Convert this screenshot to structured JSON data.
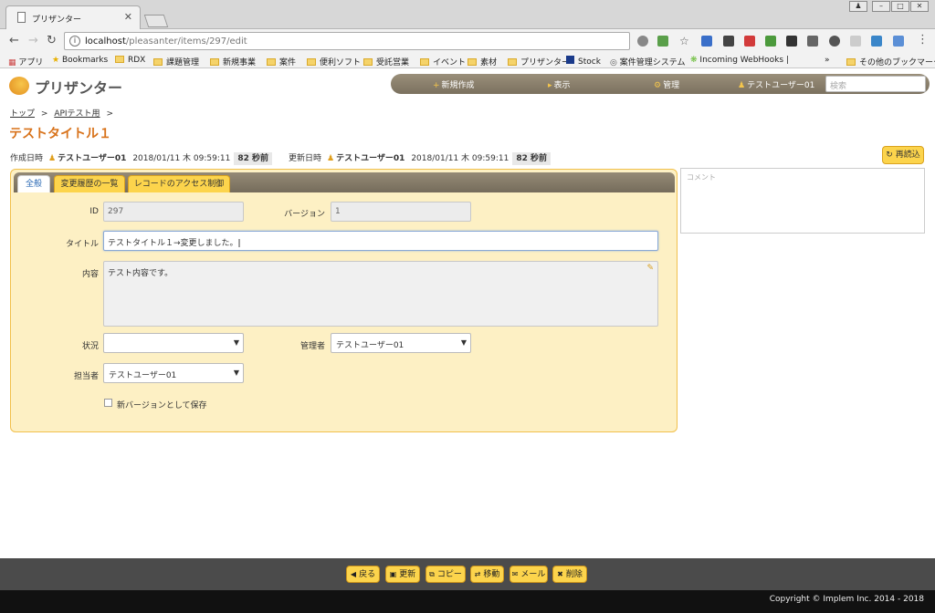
{
  "browser": {
    "tab_title": "プリザンター",
    "tab_close": "✕",
    "url_host": "localhost",
    "url_path": "/pleasanter/items/297/edit",
    "bookmarks": [
      "アプリ",
      "Bookmarks",
      "RDX",
      "課題管理",
      "新規事業",
      "案件",
      "便利ソフト",
      "受託営業",
      "イベント",
      "素材",
      "プリザンター",
      "Stock",
      "案件管理システム",
      "Incoming WebHooks | ",
      "»",
      "その他のブックマーク"
    ]
  },
  "app": {
    "logo_text": "プリザンター",
    "nav": {
      "new": "新規作成",
      "view": "表示",
      "admin": "管理",
      "user": "テストユーザー01"
    },
    "search_placeholder": "検索"
  },
  "breadcrumb": {
    "top": "トップ",
    "sep1": ">",
    "site": "APIテスト用",
    "sep2": ">"
  },
  "page_title": "テストタイトル１",
  "meta": {
    "created_label": "作成日時",
    "created_user": "テストユーザー01",
    "created_at": "2018/01/11 木 09:59:11",
    "created_ago": "82 秒前",
    "updated_label": "更新日時",
    "updated_user": "テストユーザー01",
    "updated_at": "2018/01/11 木 09:59:11",
    "updated_ago": "82 秒前"
  },
  "reload_label": "再読込",
  "tabs": [
    "全般",
    "変更履歴の一覧",
    "レコードのアクセス制御"
  ],
  "form": {
    "id_label": "ID",
    "id_value": "297",
    "version_label": "バージョン",
    "version_value": "1",
    "title_label": "タイトル",
    "title_value": "テストタイトル１→変更しました。",
    "body_label": "内容",
    "body_value": "テスト内容です。",
    "status_label": "状況",
    "status_value": "",
    "manager_label": "管理者",
    "manager_value": "テストユーザー01",
    "owner_label": "担当者",
    "owner_value": "テストユーザー01",
    "new_version_label": "新バージョンとして保存"
  },
  "comment_placeholder": "コメント",
  "footer_buttons": {
    "back": "戻る",
    "update": "更新",
    "copy": "コピー",
    "move": "移動",
    "mail": "メール",
    "delete": "削除"
  },
  "copyright": "Copyright © Implem Inc. 2014 - 2018",
  "colors": {
    "accent": "#d8721a",
    "button": "#fcd44c",
    "panel": "#fdf0c4"
  }
}
